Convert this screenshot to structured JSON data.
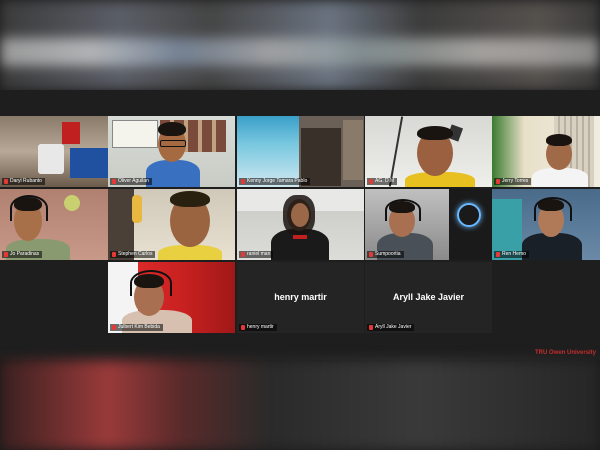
{
  "participants": [
    {
      "name": "Daryl Rubanto"
    },
    {
      "name": "Oliver Aguilan"
    },
    {
      "name": "Kenny Jorge Tamara Pablo"
    },
    {
      "name": "AG. D.M"
    },
    {
      "name": "Jerry Torres"
    },
    {
      "name": "Jo Paradinas"
    },
    {
      "name": "Stephen Carlos"
    },
    {
      "name": "raniel man"
    },
    {
      "name": "Sumpoortia"
    },
    {
      "name": "Ren Hemo"
    },
    {
      "name": "Julbert Kim Bebida"
    },
    {
      "name": "henry martir",
      "display": "henry martir"
    },
    {
      "name": "Aryll Jake Javier",
      "display": "Aryll Jake Javier"
    }
  ],
  "watermark": "TRU Owen University",
  "colors": {
    "active_border": "#e8d84a",
    "mic_muted": "#e53935",
    "watermark": "#d32f2f"
  }
}
